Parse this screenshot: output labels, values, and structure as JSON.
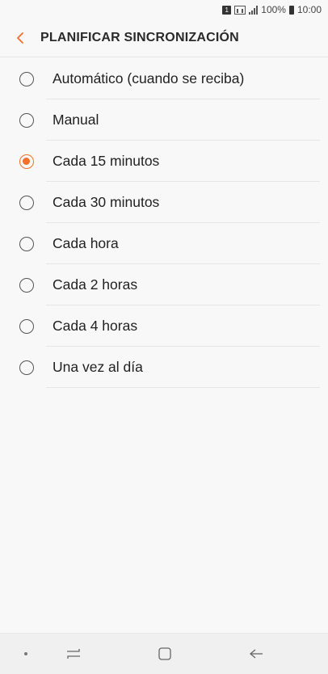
{
  "status_bar": {
    "sim_badge": "1",
    "battery_text": "100%",
    "time": "10:00"
  },
  "app_bar": {
    "back_icon": "chevron-left-icon",
    "title": "PLANIFICAR SINCRONIZACIÓN"
  },
  "sync_options": [
    {
      "label": "Automático (cuando se reciba)",
      "selected": false
    },
    {
      "label": "Manual",
      "selected": false
    },
    {
      "label": "Cada 15 minutos",
      "selected": true
    },
    {
      "label": "Cada 30 minutos",
      "selected": false
    },
    {
      "label": "Cada hora",
      "selected": false
    },
    {
      "label": "Cada 2 horas",
      "selected": false
    },
    {
      "label": "Cada 4 horas",
      "selected": false
    },
    {
      "label": "Una vez al día",
      "selected": false
    }
  ],
  "nav_bar": {
    "items": [
      "dot-icon",
      "recents-icon",
      "home-icon",
      "back-arrow-icon"
    ]
  },
  "colors": {
    "accent": "#f36f2a",
    "background": "#f8f8f8"
  }
}
